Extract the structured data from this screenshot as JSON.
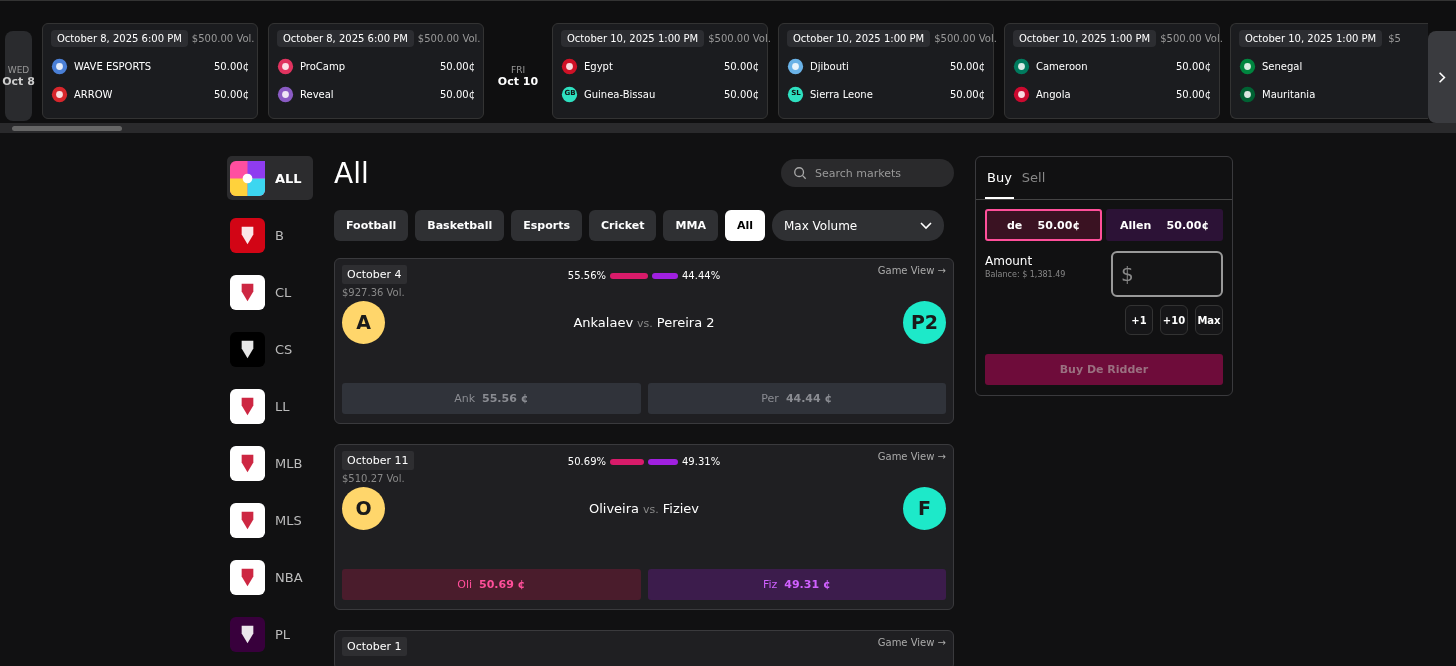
{
  "ticker": {
    "items": [
      {
        "kind": "day",
        "weekday": "WED",
        "date": "Oct 8",
        "selected": true
      },
      {
        "kind": "event",
        "time": "October 8, 2025 6:00 PM",
        "volume": "$500.00 Vol.",
        "teams": [
          {
            "name": "WAVE ESPORTS",
            "price": "50.00¢",
            "color": "#4a7fd6"
          },
          {
            "name": "ARROW",
            "price": "50.00¢",
            "color": "#d8262c"
          }
        ]
      },
      {
        "kind": "event",
        "time": "October 8, 2025 6:00 PM",
        "volume": "$500.00 Vol.",
        "teams": [
          {
            "name": "ProCamp",
            "price": "50.00¢",
            "color": "#e0335f"
          },
          {
            "name": "Reveal",
            "price": "50.00¢",
            "color": "#8a5bc4"
          }
        ]
      },
      {
        "kind": "day",
        "weekday": "FRI",
        "date": "Oct 10",
        "selected": false
      },
      {
        "kind": "event",
        "time": "October 10, 2025 1:00 PM",
        "volume": "$500.00 Vol.",
        "teams": [
          {
            "name": "Egypt",
            "price": "50.00¢",
            "color": "#ce1126"
          },
          {
            "name": "Guinea-Bissau",
            "price": "50.00¢",
            "color": "#2ee0c0",
            "badge": "GB"
          }
        ]
      },
      {
        "kind": "event",
        "time": "October 10, 2025 1:00 PM",
        "volume": "$500.00 Vol.",
        "teams": [
          {
            "name": "Djibouti",
            "price": "50.00¢",
            "color": "#6ab2e7"
          },
          {
            "name": "Sierra Leone",
            "price": "50.00¢",
            "color": "#2ee0c0",
            "badge": "SL"
          }
        ]
      },
      {
        "kind": "event",
        "time": "October 10, 2025 1:00 PM",
        "volume": "$500.00 Vol.",
        "teams": [
          {
            "name": "Cameroon",
            "price": "50.00¢",
            "color": "#007a5e"
          },
          {
            "name": "Angola",
            "price": "50.00¢",
            "color": "#cc092f"
          }
        ]
      },
      {
        "kind": "event",
        "time": "October 10, 2025 1:00 PM",
        "volume": "$5",
        "teams": [
          {
            "name": "Senegal",
            "color": "#00853f"
          },
          {
            "name": "Mauritania",
            "color": "#006233"
          }
        ]
      }
    ]
  },
  "sidebar": {
    "items": [
      {
        "label": "ALL",
        "selected": true,
        "color": "#ff4fa0"
      },
      {
        "label": "B",
        "selected": false,
        "color": "#d20515"
      },
      {
        "label": "CL",
        "selected": false,
        "color": "#ffffff"
      },
      {
        "label": "CS",
        "selected": false,
        "color": "#000000"
      },
      {
        "label": "LL",
        "selected": false,
        "color": "#ffffff"
      },
      {
        "label": "MLB",
        "selected": false,
        "color": "#ffffff"
      },
      {
        "label": "MLS",
        "selected": false,
        "color": "#ffffff"
      },
      {
        "label": "NBA",
        "selected": false,
        "color": "#ffffff"
      },
      {
        "label": "PL",
        "selected": false,
        "color": "#38003c"
      }
    ]
  },
  "title": "All",
  "search": {
    "placeholder": "Search markets"
  },
  "filters": [
    {
      "label": "Football",
      "selected": false
    },
    {
      "label": "Basketball",
      "selected": false
    },
    {
      "label": "Esports",
      "selected": false
    },
    {
      "label": "Cricket",
      "selected": false
    },
    {
      "label": "MMA",
      "selected": false
    },
    {
      "label": "All",
      "selected": true
    }
  ],
  "sort": {
    "value": "Max Volume"
  },
  "markets": [
    {
      "date": "October 4",
      "volume": "$927.36 Vol.",
      "left_pct": "55.56%",
      "right_pct": "44.44%",
      "level": 0.5556,
      "link": "Game View →",
      "active": false,
      "home": {
        "avatar": "A",
        "name": "Ankalaev",
        "color": "#ffd66b"
      },
      "separator": "vs.",
      "away": {
        "avatar": "P2",
        "name": "Pereira 2",
        "color": "#1de9c9"
      },
      "outcomes": [
        {
          "short": "Ank",
          "price": "55.56 ¢"
        },
        {
          "short": "Per",
          "price": "44.44 ¢"
        }
      ]
    },
    {
      "date": "October 11",
      "volume": "$510.27 Vol.",
      "left_pct": "50.69%",
      "right_pct": "49.31%",
      "level": 0.5069,
      "link": "Game View →",
      "active": true,
      "home": {
        "avatar": "O",
        "name": "Oliveira",
        "color": "#ffd66b"
      },
      "separator": "vs.",
      "away": {
        "avatar": "F",
        "name": "Fiziev",
        "color": "#1de9c9"
      },
      "outcomes": [
        {
          "short": "Oli",
          "price": "50.69 ¢"
        },
        {
          "short": "Fiz",
          "price": "49.31 ¢"
        }
      ]
    },
    {
      "date": "October 1",
      "link": "Game View →"
    }
  ],
  "trade": {
    "tabs": [
      {
        "label": "Buy",
        "selected": true
      },
      {
        "label": "Sell",
        "selected": false
      }
    ],
    "outcomes": [
      {
        "name": "de",
        "price": "50.00¢",
        "selected": true
      },
      {
        "name": "Allen",
        "price": "50.00¢",
        "selected": false
      }
    ],
    "amount_label": "Amount",
    "balance": "Balance: $ 1,381.49",
    "placeholder": "$",
    "quick": [
      "+1",
      "+10",
      "Max"
    ],
    "submit": {
      "label": "Buy De Ridder",
      "disabled": true
    }
  }
}
